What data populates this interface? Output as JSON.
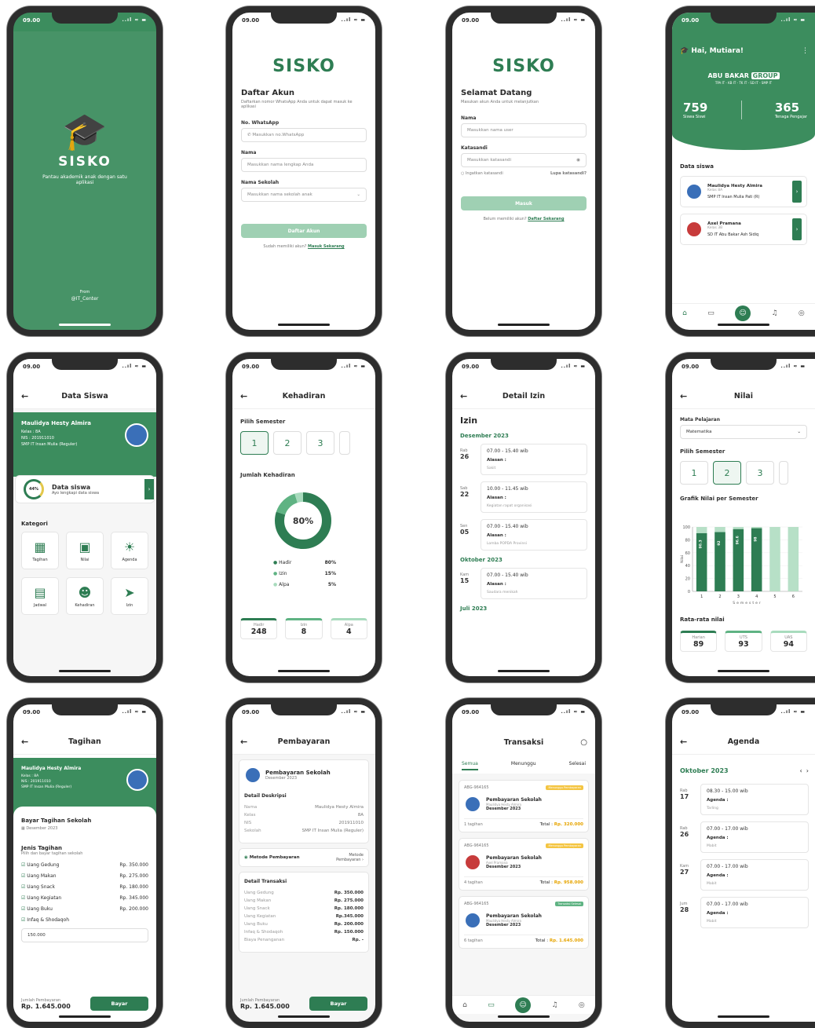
{
  "status": {
    "time": "09.00",
    "icons": "..ıl ≈ ▬"
  },
  "splash": {
    "brand": "SISKO",
    "tagline": "Pantau akademik anak dengan satu aplikasi",
    "from": "From",
    "company": "@IT_Center"
  },
  "register": {
    "brand": "SISKO",
    "title": "Daftar Akun",
    "subtitle": "Daftarkan nomor WhatsApp Anda untuk dapat masuk ke aplikasi",
    "wa_label": "No. WhatsApp",
    "wa_ph": "Masukkan no.WhatsApp",
    "name_label": "Nama",
    "name_ph": "Masukkan nama lengkap Anda",
    "school_label": "Nama Sekolah",
    "school_ph": "Masukkan nama sekolah anak",
    "button": "Daftar Akun",
    "have_account": "Sudah memiliki akun?",
    "login_link": "Masuk Sekarang"
  },
  "login": {
    "brand": "SISKO",
    "title": "Selamat Datang",
    "subtitle": "Masukan akun Anda untuk melanjutkan",
    "name_label": "Nama",
    "name_ph": "Masukkan nama user",
    "pw_label": "Katasandi",
    "pw_ph": "Masukkan katasandi",
    "remember": "Ingatkan katasandi",
    "forgot": "Lupa katasandi?",
    "button": "Masuk",
    "no_account": "Belum memiliki akun?",
    "register_link": "Daftar Sekarang"
  },
  "home": {
    "greeting": "Hai, Mutiara!",
    "group_a": "ABU BAKAR",
    "group_b": "GROUP",
    "units": "TPA IT - KB IT - TK IT - SD IT - SMP IT",
    "students": "759",
    "students_label": "Siswa Siswi",
    "teachers": "365",
    "teachers_label": "Tenaga Pengajar",
    "section": "Data siswa",
    "kids": [
      {
        "name": "Maulidya Hesty Almira",
        "kelas": "Kelas 8A",
        "school": "SMP IT Insan Mulia Pati (R)"
      },
      {
        "name": "Axel Pramana",
        "kelas": "Kelas 3B",
        "school": "SD IT Abu Bakar Ash Sidiq"
      }
    ]
  },
  "datasiswa": {
    "title": "Data Siswa",
    "name": "Maulidya Hesty Almira",
    "kelas": "Kelas     :  8A",
    "nis": "NIS        :  201911010",
    "school": "SMP IT Insan Mulia (Reguler)",
    "pct": "44%",
    "card_title": "Data siswa",
    "card_sub": "Ayo lengkapi data siswa",
    "kategori": "Kategori",
    "cats": [
      "Tagihan",
      "Nilai",
      "Agenda",
      "Jadwal",
      "Kehadiran",
      "Izin"
    ]
  },
  "kehadiran": {
    "title": "Kehadiran",
    "semester_label": "Pilih Semester",
    "sems": [
      "1",
      "2",
      "3"
    ],
    "jumlah": "Jumlah Kehadiran",
    "center": "80%",
    "legend": [
      {
        "k": "Hadir",
        "v": "80%"
      },
      {
        "k": "Izin",
        "v": "15%"
      },
      {
        "k": "Alpa",
        "v": "5%"
      }
    ],
    "stats": [
      {
        "k": "Hadir",
        "v": "248"
      },
      {
        "k": "Izin",
        "v": "8"
      },
      {
        "k": "Alpa",
        "v": "4"
      }
    ]
  },
  "izin": {
    "title": "Detail Izin",
    "heading": "Izin",
    "m1": "Desember 2023",
    "m2": "Oktober 2023",
    "m3": "Juli 2023",
    "alasan": "Alasan :",
    "entries": [
      {
        "day": "Rab",
        "date": "26",
        "time": "07.00 - 15.40 wib",
        "reason": "Sakit"
      },
      {
        "day": "Sab",
        "date": "22",
        "time": "10.00 - 11.45 wib",
        "reason": "Kegiatan rapat organisasi"
      },
      {
        "day": "Sen",
        "date": "05",
        "time": "07.00 - 15.40 wib",
        "reason": "Lomba POPDA Provinsi"
      },
      {
        "day": "Kam",
        "date": "15",
        "time": "07.00 - 15.40 wib",
        "reason": "Saudara menikah"
      }
    ]
  },
  "nilai": {
    "title": "Nilai",
    "mapel_label": "Mata Pelajaran",
    "mapel": "Matematika",
    "semester_label": "Pilih Semester",
    "sems": [
      "1",
      "2",
      "3"
    ],
    "chart_title": "Grafik Nilai per Semester",
    "avg_label": "Rata-rata nilai",
    "stats": [
      {
        "k": "Harian",
        "v": "89"
      },
      {
        "k": "UTS",
        "v": "93"
      },
      {
        "k": "UAS",
        "v": "94"
      }
    ]
  },
  "chart_data": {
    "type": "bar",
    "x": [
      1,
      2,
      3,
      4,
      5,
      6
    ],
    "values": [
      90.3,
      92,
      96.6,
      98,
      null,
      null
    ],
    "bar_labels": [
      "90.3",
      "92",
      "96.6",
      "98",
      "",
      ""
    ],
    "ylim": [
      0,
      100
    ],
    "yticks": [
      0,
      20,
      40,
      60,
      80,
      100
    ],
    "xlabel": "Semester",
    "ylabel": "Nilai"
  },
  "tagihan": {
    "title": "Tagihan",
    "name": "Maulidya Hesty Almira",
    "kelas": "Kelas     :  8A",
    "nis": "NIS        :  201911010",
    "school": "SMP IT Insan Mulia (Reguler)",
    "bayar_title": "Bayar Tagihan Sekolah",
    "month": "Desember 2023",
    "jenis": "Jenis Tagihan",
    "jenis_sub": "Pilih dan bayar tagihan sekolah",
    "items": [
      {
        "k": "Uang Gedung",
        "v": "Rp. 350.000"
      },
      {
        "k": "Uang Makan",
        "v": "Rp. 275.000"
      },
      {
        "k": "Uang Snack",
        "v": "Rp. 180.000"
      },
      {
        "k": "Uang Kegiatan",
        "v": "Rp. 345.000"
      },
      {
        "k": "Uang Buku",
        "v": "Rp. 200.000"
      },
      {
        "k": "Infaq & Shodaqoh",
        "v": ""
      }
    ],
    "infaq_value": "150.000",
    "total_label": "Jumlah Pembayaran",
    "total": "Rp. 1.645.000",
    "button": "Bayar"
  },
  "pembayaran": {
    "title": "Pembayaran",
    "pay_title": "Pembayaran Sekolah",
    "month": "Desember 2023",
    "detail": "Detail Deskripsi",
    "fields": [
      {
        "k": "Nama",
        "v": "Maulidya Hesty Almira"
      },
      {
        "k": "Kelas",
        "v": "8A"
      },
      {
        "k": "NIS",
        "v": "201911010"
      },
      {
        "k": "Sekolah",
        "v": "SMP IT Insan Mulia (Reguler)"
      }
    ],
    "metode": "Metode Pembayaran",
    "metode_r": "Metode Pembayaran",
    "trans": "Detail Transaksi",
    "items": [
      {
        "k": "Uang Gedung",
        "v": "Rp. 350.000"
      },
      {
        "k": "Uang Makan",
        "v": "Rp. 275.000"
      },
      {
        "k": "Uang Snack",
        "v": "Rp. 180.000"
      },
      {
        "k": "Uang Kegiatan",
        "v": "Rp.345.000"
      },
      {
        "k": "Uang Buku",
        "v": "Rp. 200.000"
      },
      {
        "k": "Infaq & Shodaqoh",
        "v": "Rp. 150.000"
      },
      {
        "k": "Biaya Penanganan",
        "v": "Rp. -"
      }
    ],
    "total_label": "Jumlah Pembayaran",
    "total": "Rp. 1.645.000",
    "button": "Bayar"
  },
  "transaksi": {
    "title": "Transaksi",
    "tabs": [
      "Semua",
      "Menunggu",
      "Selesai"
    ],
    "list": [
      {
        "id": "ABG-964165",
        "badge": "Menunggu Pembayaran",
        "title": "Pembayaran Sekolah",
        "name": "Maulidya Hesty Almira",
        "month": "Desember 2023",
        "count": "1 tagihan",
        "total": "Rp. 320.000"
      },
      {
        "id": "ABG-964165",
        "badge": "Menunggu Pembayaran",
        "title": "Pembayaran Sekolah",
        "name": "Axel Pramana",
        "month": "Desember 2023",
        "count": "4 tagihan",
        "total": "Rp. 958.000"
      },
      {
        "id": "ABG-964165",
        "badge": "Transaksi Selesai",
        "title": "Pembayaran Sekolah",
        "name": "Maulidya Hesty Almira",
        "month": "Desember 2023",
        "count": "6 tagihan",
        "total": "Rp. 1.645.000"
      }
    ],
    "total_prefix": "Total :"
  },
  "agenda": {
    "title": "Agenda",
    "month": "Oktober 2023",
    "label": "Agenda :",
    "entries": [
      {
        "day": "Rab",
        "date": "17",
        "time": "08.30 - 15.00 wib",
        "what": "Tarling"
      },
      {
        "day": "Rab",
        "date": "26",
        "time": "07.00 - 17.00 wib",
        "what": "Mabit"
      },
      {
        "day": "Kam",
        "date": "27",
        "time": "07.00 - 17.00 wib",
        "what": "Mabit"
      },
      {
        "day": "Jum",
        "date": "28",
        "time": "07.00 - 17.00 wib",
        "what": "Mabit"
      }
    ]
  }
}
